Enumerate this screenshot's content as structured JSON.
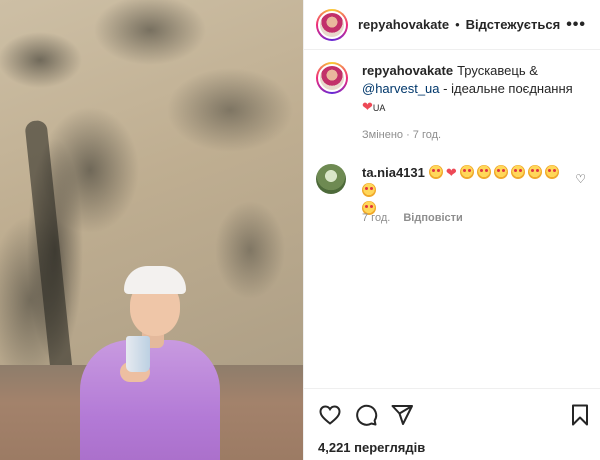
{
  "post": {
    "username": "repyahovakate",
    "follow_state": "Відстежується",
    "caption_prefix": "Трускавець &",
    "mention": "@harvest_ua",
    "caption_suffix": "- ідеальне поєднання",
    "caption_flag_text": "UA",
    "edited_label": "Змінено · 7 год."
  },
  "comment": {
    "username": "ta.nia4131",
    "time": "7 год.",
    "reply_label": "Відповісти"
  },
  "views": "4,221 переглядів",
  "icons": {
    "more": "more-horizontal-icon",
    "like": "heart-outline-icon",
    "comment": "comment-bubble-icon",
    "share": "paper-plane-icon",
    "save": "bookmark-icon"
  },
  "colors": {
    "mention": "#00376b",
    "heart": "#ed4956",
    "meta": "#8e8e8e"
  }
}
